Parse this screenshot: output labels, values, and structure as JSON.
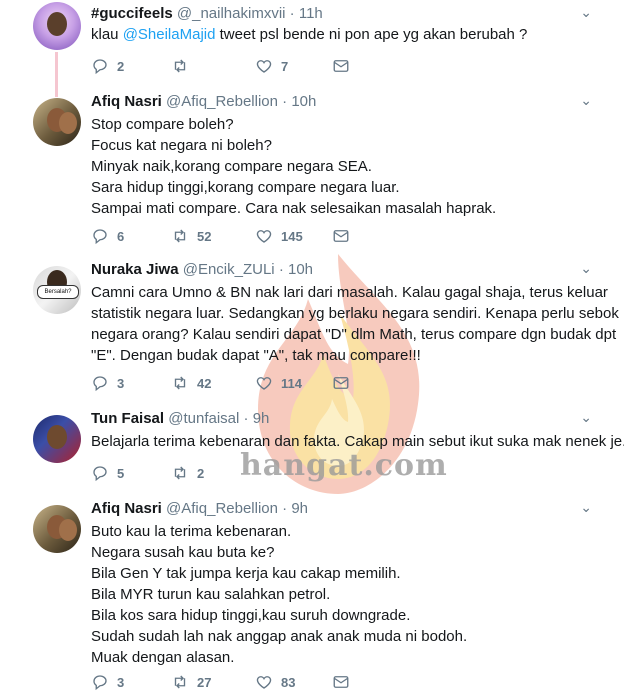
{
  "tweets": [
    {
      "name": "#guccifeels",
      "handle": "@_nailhakimxvii",
      "time": "11h",
      "lines": [],
      "mention_prefix": "klau ",
      "mention": "@SheilaMajid",
      "mention_suffix": " tweet psl bende ni pon ape yg akan berubah ?",
      "replies": "2",
      "retweets": "",
      "likes": "7"
    },
    {
      "name": "Afiq Nasri",
      "handle": "@Afiq_Rebellion",
      "time": "10h",
      "lines": [
        "Stop compare boleh?",
        "Focus kat negara ni boleh?",
        "Minyak naik,korang compare negara SEA.",
        "Sara hidup tinggi,korang compare negara luar.",
        "Sampai mati compare. Cara nak selesaikan masalah haprak."
      ],
      "replies": "6",
      "retweets": "52",
      "likes": "145"
    },
    {
      "name": "Nuraka Jiwa",
      "handle": "@Encik_ZULi",
      "time": "10h",
      "avatar_tag": "Bersalah?",
      "lines": [
        "Camni cara Umno & BN nak lari dari masalah. Kalau gagal shaja, terus keluar",
        "statistik negara luar. Sedangkan yg berlaku negara sendiri. Kenapa perlu sebok",
        "negara orang? Kalau sendiri dapat \"D\" dlm Math, terus compare dgn budak dpt",
        "\"E\". Dengan budak dapat \"A\", tak mau compare!!!"
      ],
      "replies": "3",
      "retweets": "42",
      "likes": "114"
    },
    {
      "name": "Tun Faisal",
      "handle": "@tunfaisal",
      "time": "9h",
      "lines": [
        "Belajarla terima kebenaran dan fakta. Cakap main sebut ikut suka mak nenek je."
      ],
      "replies": "5",
      "retweets": "2",
      "likes": ""
    },
    {
      "name": "Afiq Nasri",
      "handle": "@Afiq_Rebellion",
      "time": "9h",
      "lines": [
        "Buto kau la terima kebenaran.",
        "Negara susah kau buta ke?",
        "Bila Gen Y tak jumpa kerja kau cakap memilih.",
        "Bila MYR turun kau salahkan petrol.",
        "Bila kos sara hidup tinggi,kau suruh downgrade.",
        "Sudah sudah lah nak anggap anak anak muda ni bodoh.",
        "Muak dengan alasan."
      ],
      "replies": "3",
      "retweets": "27",
      "likes": "83"
    }
  ],
  "dot": "·",
  "watermark": "hangat.com",
  "colors": {
    "link": "#1da1f2",
    "muted": "#657786",
    "thread": "#f5c6d0"
  }
}
